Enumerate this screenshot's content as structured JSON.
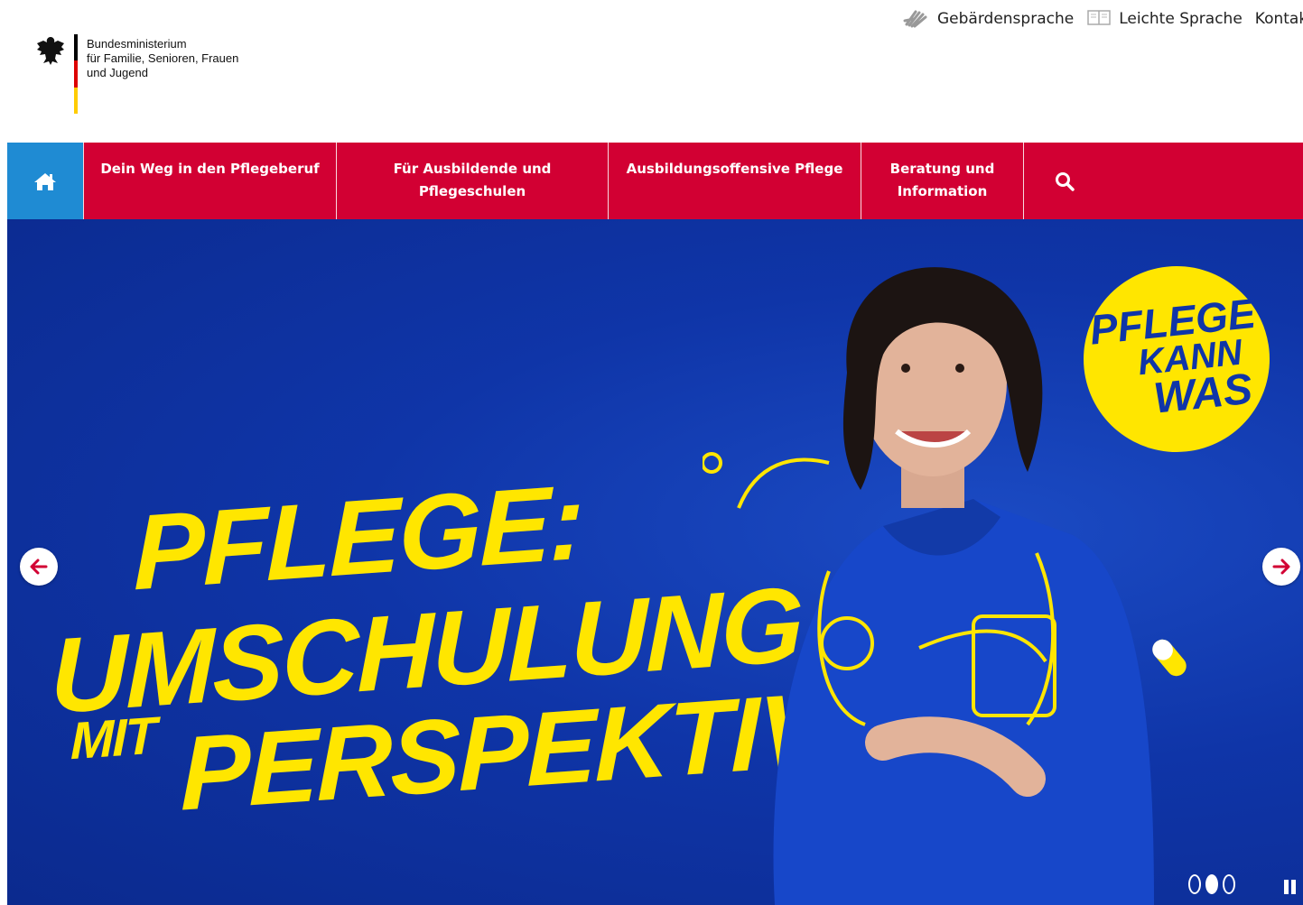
{
  "utility_links": {
    "sign_language": "Gebärdensprache",
    "easy_language": "Leichte Sprache",
    "contact": "Kontakt"
  },
  "logo": {
    "line1": "Bundesministerium",
    "line2": "für Familie, Senioren, Frauen",
    "line3": "und Jugend"
  },
  "nav": {
    "home_icon": "home-icon",
    "items": [
      {
        "line1": "Dein Weg in den Pflegeberuf",
        "line2": ""
      },
      {
        "line1": "Für Ausbildende und",
        "line2": "Pflegeschulen"
      },
      {
        "line1": "Ausbildungsoffensive Pflege",
        "line2": ""
      },
      {
        "line1": "Beratung und",
        "line2": "Information"
      }
    ],
    "search_icon": "search-icon"
  },
  "hero": {
    "headline_1": "PFLEGE:",
    "headline_2": "UMSCHULUNG",
    "headline_3a": "MIT",
    "headline_3b": "PERSPEKTIVE",
    "badge": {
      "line1": "PFLEGE",
      "line2": "KANN",
      "line3": "WAS"
    },
    "slides_total": 3,
    "active_slide": 2
  },
  "colors": {
    "nav_red": "#d20033",
    "home_blue": "#1f8bd3",
    "hero_blue": "#0f35a8",
    "accent_yellow": "#ffe600"
  }
}
